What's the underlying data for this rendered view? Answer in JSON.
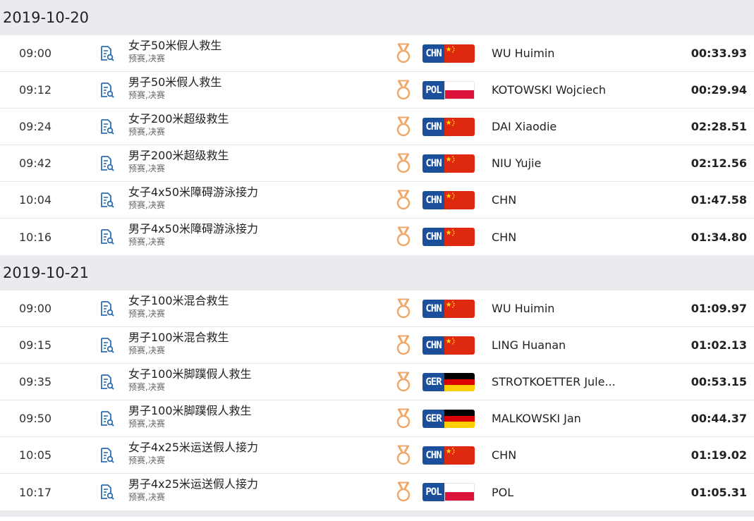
{
  "days": [
    {
      "date": "2019-10-20",
      "events": [
        {
          "time": "09:00",
          "name": "女子50米假人救生",
          "sub": "预赛,决赛",
          "code": "CHN",
          "athlete": "WU Huimin",
          "result": "00:33.93"
        },
        {
          "time": "09:12",
          "name": "男子50米假人救生",
          "sub": "预赛,决赛",
          "code": "POL",
          "athlete": "KOTOWSKI Wojciech",
          "result": "00:29.94"
        },
        {
          "time": "09:24",
          "name": "女子200米超级救生",
          "sub": "预赛,决赛",
          "code": "CHN",
          "athlete": "DAI Xiaodie",
          "result": "02:28.51"
        },
        {
          "time": "09:42",
          "name": "男子200米超级救生",
          "sub": "预赛,决赛",
          "code": "CHN",
          "athlete": "NIU Yujie",
          "result": "02:12.56"
        },
        {
          "time": "10:04",
          "name": "女子4x50米障碍游泳接力",
          "sub": "预赛,决赛",
          "code": "CHN",
          "athlete": "CHN",
          "result": "01:47.58"
        },
        {
          "time": "10:16",
          "name": "男子4x50米障碍游泳接力",
          "sub": "预赛,决赛",
          "code": "CHN",
          "athlete": "CHN",
          "result": "01:34.80"
        }
      ]
    },
    {
      "date": "2019-10-21",
      "events": [
        {
          "time": "09:00",
          "name": "女子100米混合救生",
          "sub": "预赛,决赛",
          "code": "CHN",
          "athlete": "WU Huimin",
          "result": "01:09.97"
        },
        {
          "time": "09:15",
          "name": "男子100米混合救生",
          "sub": "预赛,决赛",
          "code": "CHN",
          "athlete": "LING Huanan",
          "result": "01:02.13"
        },
        {
          "time": "09:35",
          "name": "女子100米脚蹼假人救生",
          "sub": "预赛,决赛",
          "code": "GER",
          "athlete": "STROTKOETTER Jule...",
          "result": "00:53.15"
        },
        {
          "time": "09:50",
          "name": "男子100米脚蹼假人救生",
          "sub": "预赛,决赛",
          "code": "GER",
          "athlete": "MALKOWSKI Jan",
          "result": "00:44.37"
        },
        {
          "time": "10:05",
          "name": "女子4x25米运送假人接力",
          "sub": "预赛,决赛",
          "code": "CHN",
          "athlete": "CHN",
          "result": "01:19.02"
        },
        {
          "time": "10:17",
          "name": "男子4x25米运送假人接力",
          "sub": "预赛,决赛",
          "code": "POL",
          "athlete": "POL",
          "result": "01:05.31"
        }
      ]
    }
  ],
  "icons": {
    "details": "document-search-icon",
    "medal": "gold-medal-icon"
  },
  "colors": {
    "badge_blue": "#1b4f9c",
    "header_bg": "#e9ebef",
    "medal": "#f0a868",
    "icon_blue": "#2f6db5"
  }
}
